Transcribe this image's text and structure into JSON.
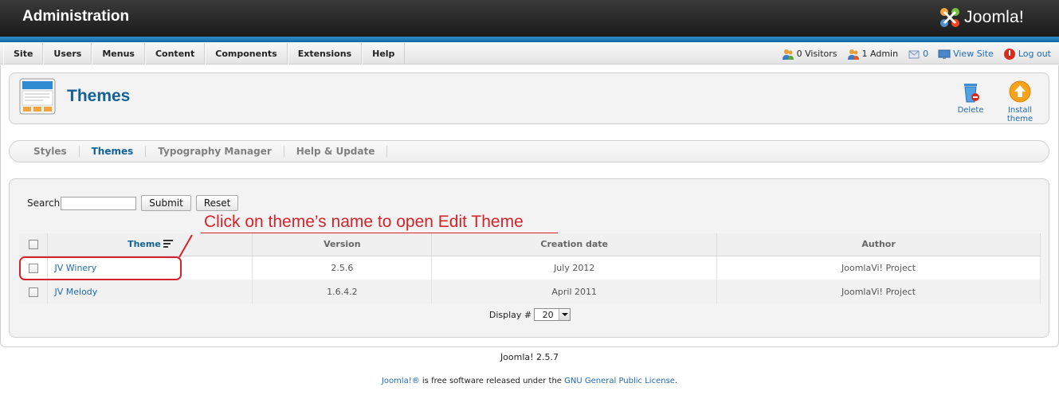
{
  "header": {
    "title": "Administration",
    "logo_text": "Joomla!"
  },
  "menu": {
    "items": [
      {
        "label": "Site"
      },
      {
        "label": "Users"
      },
      {
        "label": "Menus"
      },
      {
        "label": "Content"
      },
      {
        "label": "Components"
      },
      {
        "label": "Extensions"
      },
      {
        "label": "Help"
      }
    ]
  },
  "status": {
    "visitors": "0 Visitors",
    "admin": "1 Admin",
    "messages": "0",
    "view_site": "View Site",
    "logout": "Log out"
  },
  "toolbar": {
    "page_title": "Themes",
    "delete_label": "Delete",
    "install_label": "Install theme"
  },
  "submenu": {
    "items": [
      {
        "label": "Styles"
      },
      {
        "label": "Themes"
      },
      {
        "label": "Typography Manager"
      },
      {
        "label": "Help & Update"
      }
    ],
    "active": "Themes"
  },
  "filter": {
    "search_label": "Search",
    "search_value": "",
    "submit_label": "Submit",
    "reset_label": "Reset"
  },
  "annotation": "Click on theme’s name to open Edit Theme",
  "table": {
    "columns": [
      "Theme",
      "Version",
      "Creation date",
      "Author"
    ],
    "rows": [
      {
        "name": "JV Winery",
        "version": "2.5.6",
        "date": "July 2012",
        "author": "JoomlaVi! Project"
      },
      {
        "name": "JV Melody",
        "version": "1.6.4.2",
        "date": "April 2011",
        "author": "JoomlaVi! Project"
      }
    ]
  },
  "pagination": {
    "display_label": "Display #",
    "display_value": "20"
  },
  "footer": {
    "version": "Joomla! 2.5.7",
    "license_link1": "Joomla!®",
    "license_text": " is free software released under the ",
    "license_link2": "GNU General Public License",
    "license_end": "."
  },
  "colors": {
    "accent": "#146295",
    "link": "#1f6ab0",
    "annotation": "#d4232a",
    "header": "#1a1a1a",
    "strip": "#1468a8"
  }
}
